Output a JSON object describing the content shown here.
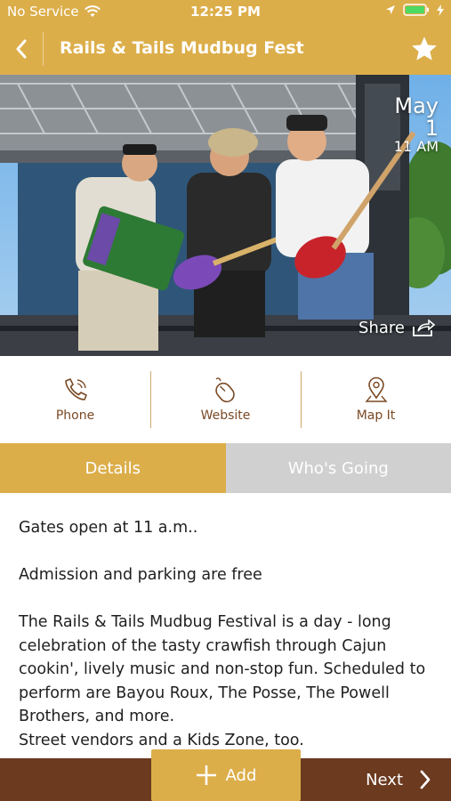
{
  "status_bar": {
    "carrier": "No Service",
    "time": "12:25 PM",
    "icons": [
      "wifi-icon",
      "location-arrow-icon",
      "battery-icon",
      "charging-bolt-icon"
    ]
  },
  "nav": {
    "title": "Rails & Tails Mudbug Fest",
    "back_icon": "chevron-left-icon",
    "favorite_icon": "star-icon"
  },
  "hero": {
    "date_month": "May",
    "date_day": "1",
    "date_time": "11 AM",
    "share_label": "Share"
  },
  "actions": [
    {
      "label": "Phone",
      "icon": "phone-icon"
    },
    {
      "label": "Website",
      "icon": "mouse-icon"
    },
    {
      "label": "Map It",
      "icon": "map-pin-icon"
    }
  ],
  "tabs": {
    "details": "Details",
    "whos_going": "Who's Going"
  },
  "content": {
    "p1": "Gates open at 11 a.m..",
    "p2": "Admission and parking are free",
    "p3": "The Rails & Tails Mudbug Festival is a day - long celebration of the tasty crawfish through Cajun cookin', lively music and non-stop fun.  Scheduled to perform are Bayou Roux, The Posse, The Powell Brothers, and more.",
    "p4": "Street vendors and a Kids Zone, too."
  },
  "bottom": {
    "add_label": "Add",
    "next_label": "Next"
  },
  "colors": {
    "accent": "#dcae4a",
    "brown": "#6b3a1f",
    "action_text": "#7a4a25",
    "tab_inactive": "#d0d0d0"
  }
}
